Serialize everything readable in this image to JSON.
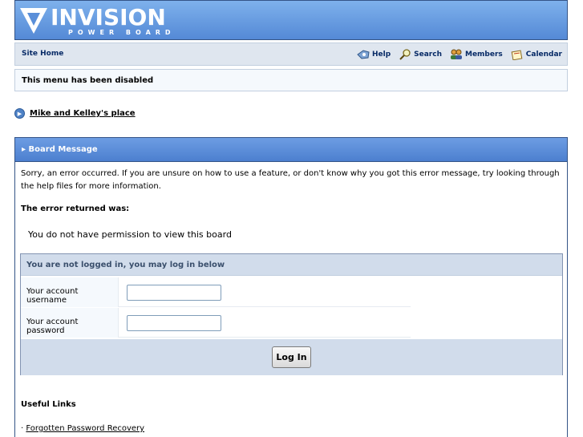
{
  "header": {
    "logo_word": "INVISION",
    "logo_sub": "POWER BOARD"
  },
  "nav": {
    "site_home": "Site Home",
    "links": [
      {
        "label": "Help",
        "icon": "help-icon"
      },
      {
        "label": "Search",
        "icon": "search-icon"
      },
      {
        "label": "Members",
        "icon": "members-icon"
      },
      {
        "label": "Calendar",
        "icon": "calendar-icon"
      }
    ]
  },
  "menu_disabled": "This menu has been disabled",
  "board_link": "Mike and Kelley's place",
  "board_message": {
    "title": "Board Message",
    "intro": "Sorry, an error occurred. If you are unsure on how to use a feature, or don't know why you got this error message, try looking through the help files for more information.",
    "error_title": "The error returned was:",
    "error_text": "You do not have permission to view this board"
  },
  "login": {
    "heading": "You are not logged in, you may log in below",
    "username_label": "Your account username",
    "password_label": "Your account password",
    "username_value": "",
    "password_value": "",
    "button": "Log In"
  },
  "useful_links": {
    "title": "Useful Links",
    "bullet": "·",
    "items": [
      "Forgotten Password Recovery"
    ]
  }
}
